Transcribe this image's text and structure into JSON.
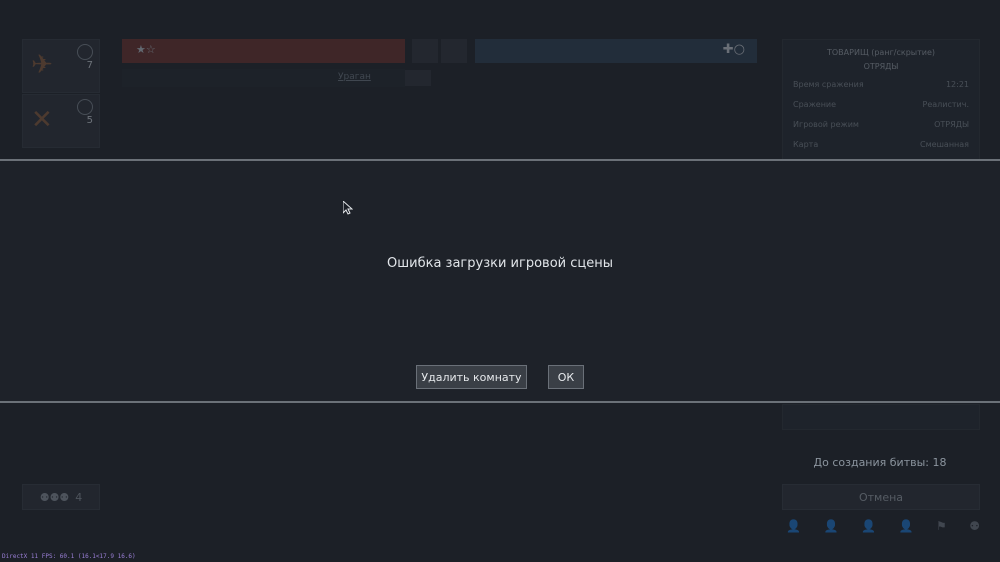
{
  "background_colors": {
    "base": "#1c2027",
    "modal": "#1e2229",
    "team_red": "#6a2f2a",
    "team_blue": "#2b3d52"
  },
  "left_slots": [
    {
      "count": "7"
    },
    {
      "count": "5"
    }
  ],
  "tabs": {
    "link_label": "Ураган"
  },
  "info_panel": {
    "title": "ТОВАРИЩ (ранг/скрытие)",
    "subtitle": "ОТРЯДЫ",
    "rows": [
      {
        "label": "Время сражения",
        "value": "12:21"
      },
      {
        "label": "Сражение",
        "value": "Реалистич."
      },
      {
        "label": "Игровой режим",
        "value": "ОТРЯДЫ"
      },
      {
        "label": "Карта",
        "value": "Смешанная"
      }
    ]
  },
  "countdown": "До создания битвы: 18",
  "cancel_label": "Отмена",
  "squad_count": "4",
  "modal": {
    "message": "Ошибка загрузки игровой сцены",
    "delete_room_label": "Удалить комнату",
    "ok_label": "ОК"
  },
  "fps_text": "DirectX 11 FPS: 60.1 (16.1<17.9 16.6)",
  "icons": [
    "tank-icon",
    "plane-icon",
    "gear-icon",
    "star-icon",
    "cross-icon",
    "circle-icon",
    "add-user-icon",
    "flag-icon",
    "group-icon",
    "cursor-icon"
  ]
}
